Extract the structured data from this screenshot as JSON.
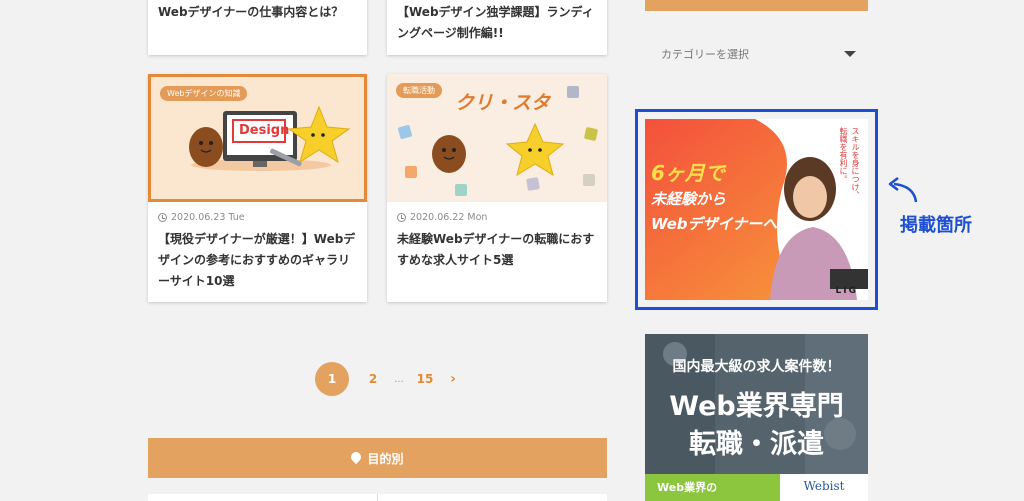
{
  "cards_top": [
    {
      "title": "Webデザイナーの仕事内容とは？"
    },
    {
      "title": "【Webデザイン独学課題】ランディングページ制作編!!"
    }
  ],
  "cards": [
    {
      "tag": "Webデザインの知識",
      "thumb_text": "Design",
      "date": "2020.06.23 Tue",
      "title": "【現役デザイナーが厳選！】Webデザインの参考におすすめのギャラリーサイト10選"
    },
    {
      "tag": "転職活動",
      "thumb_text": "クリ・スタ",
      "date": "2020.06.22 Mon",
      "title": "未経験Webデザイナーの転職におすすめな求人サイト5選"
    }
  ],
  "pagination": {
    "current": "1",
    "next_page": "2",
    "ellipsis": "...",
    "last": "15",
    "next_icon": "›"
  },
  "purpose_bar": {
    "label": "目的別"
  },
  "category_select": {
    "label": "カテゴリーを選択"
  },
  "banner_lig": {
    "headline_1": "6ヶ月で",
    "headline_2": "未経験から",
    "headline_3": "Webデザイナーへ。",
    "vertical_copy_1": "スキルを身につけ、",
    "vertical_copy_2": "転職を有利に。",
    "logo": "LIG"
  },
  "annotation": {
    "label": "掲載箇所"
  },
  "banner_webist": {
    "top_copy": "国内最大級の求人案件数！",
    "headline_1": "Web業界専門",
    "headline_2": "転職・派遣",
    "bottom_left": "Web業界の",
    "logo": "Webist"
  },
  "colors": {
    "accent": "#e4a261",
    "annotation_blue": "#1c4fd1"
  }
}
